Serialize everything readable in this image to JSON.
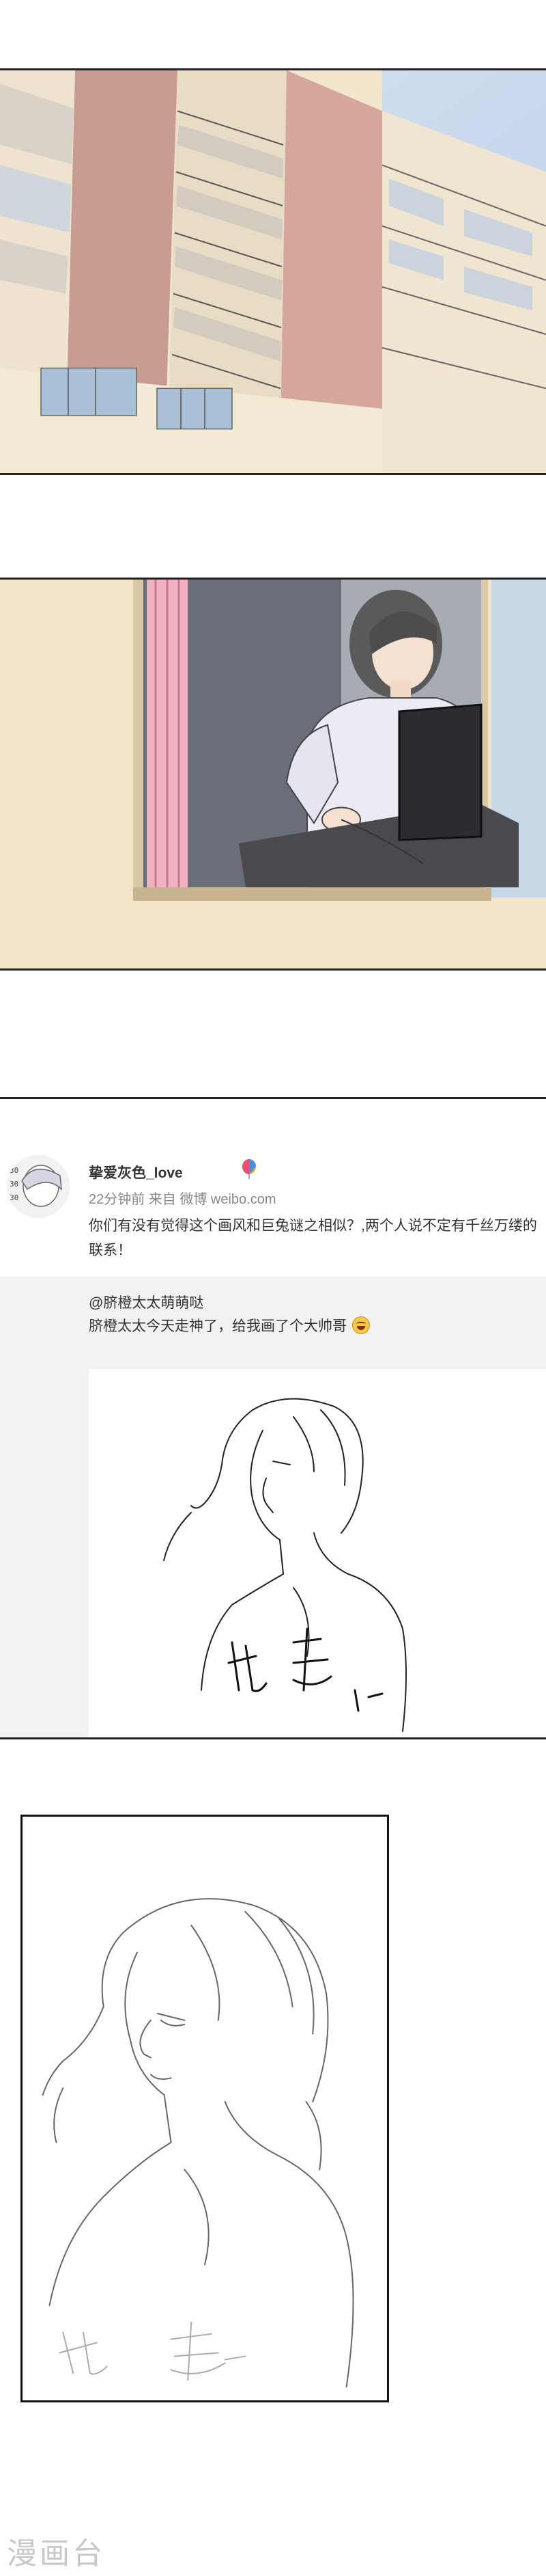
{
  "weibo": {
    "username": "挚爱灰色_love",
    "vip_icon": "rainbow-balloon-icon",
    "meta": "22分钟前 来自 微博 weibo.com",
    "post_text": "你们有没有觉得这个画风和巨兔谜之相似？,两个人说不定有千丝万缕的联系！",
    "repost_user": "@脐橙太太萌萌哒",
    "repost_text": "脐橙太太今天走神了，给我画了个大帅哥",
    "emoji": "laughing-emoji-icon"
  },
  "sketch_signature": "脐 橙",
  "watermark": "漫画台"
}
